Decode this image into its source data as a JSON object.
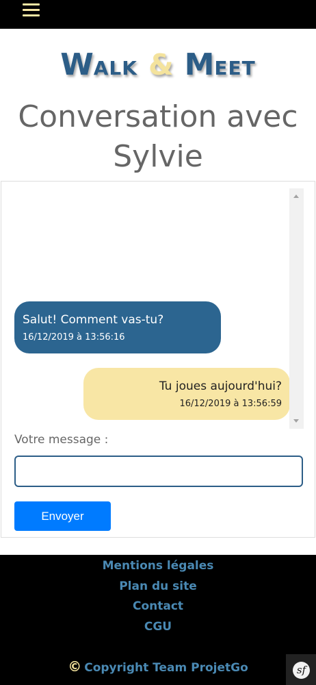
{
  "topbar": {
    "menu_icon": "hamburger-menu-icon"
  },
  "logo": {
    "walk_first": "W",
    "walk_rest": "ALK",
    "amp": "&",
    "meet_first": "M",
    "meet_rest": "EET"
  },
  "page": {
    "title": "Conversation avec Sylvie"
  },
  "conversation": {
    "messages": [
      {
        "text": "Salut! Comment vas-tu?",
        "time": "16/12/2019 à 13:56:16",
        "direction": "incoming",
        "color": "#2c6590"
      },
      {
        "text": "Tu joues aujourd'hui?",
        "time": "16/12/2019 à 13:56:59",
        "direction": "outgoing",
        "color": "#f8e6a5"
      }
    ]
  },
  "form": {
    "label": "Votre message :",
    "input_value": "",
    "send_label": "Envoyer"
  },
  "footer": {
    "links": [
      "Mentions légales",
      "Plan du site",
      "Contact",
      "CGU"
    ],
    "copyright_symbol": "©",
    "copyright": "Copyright Team ProjetGo",
    "badge_icon": "symfony-logo-icon",
    "badge_text": "sf"
  },
  "colors": {
    "brand_blue": "#2c5d87",
    "brand_yellow": "#f4e39d",
    "button_blue": "#007bff",
    "footer_link": "#4a89b3"
  }
}
